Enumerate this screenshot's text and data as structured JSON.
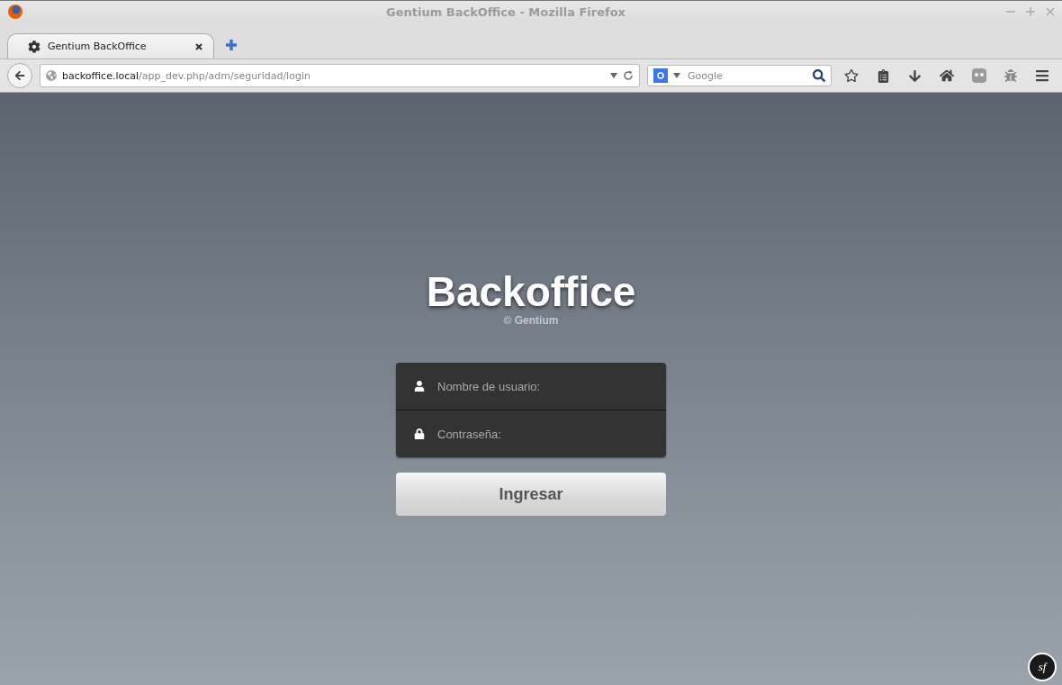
{
  "window": {
    "title": "Gentium BackOffice - Mozilla Firefox"
  },
  "tabs": [
    {
      "label": "Gentium BackOffice",
      "selected": true
    }
  ],
  "address_bar": {
    "host": "backoffice.local",
    "path": "/app_dev.php/adm/seguridad/login"
  },
  "search": {
    "placeholder": "Google"
  },
  "login": {
    "title": "Backoffice",
    "subtitle": "© Gentium",
    "username": {
      "placeholder": "Nombre de usuario:"
    },
    "password": {
      "placeholder": "Contraseña:"
    },
    "submit": "Ingresar"
  },
  "toolbar_badge": {
    "label": "sf"
  }
}
